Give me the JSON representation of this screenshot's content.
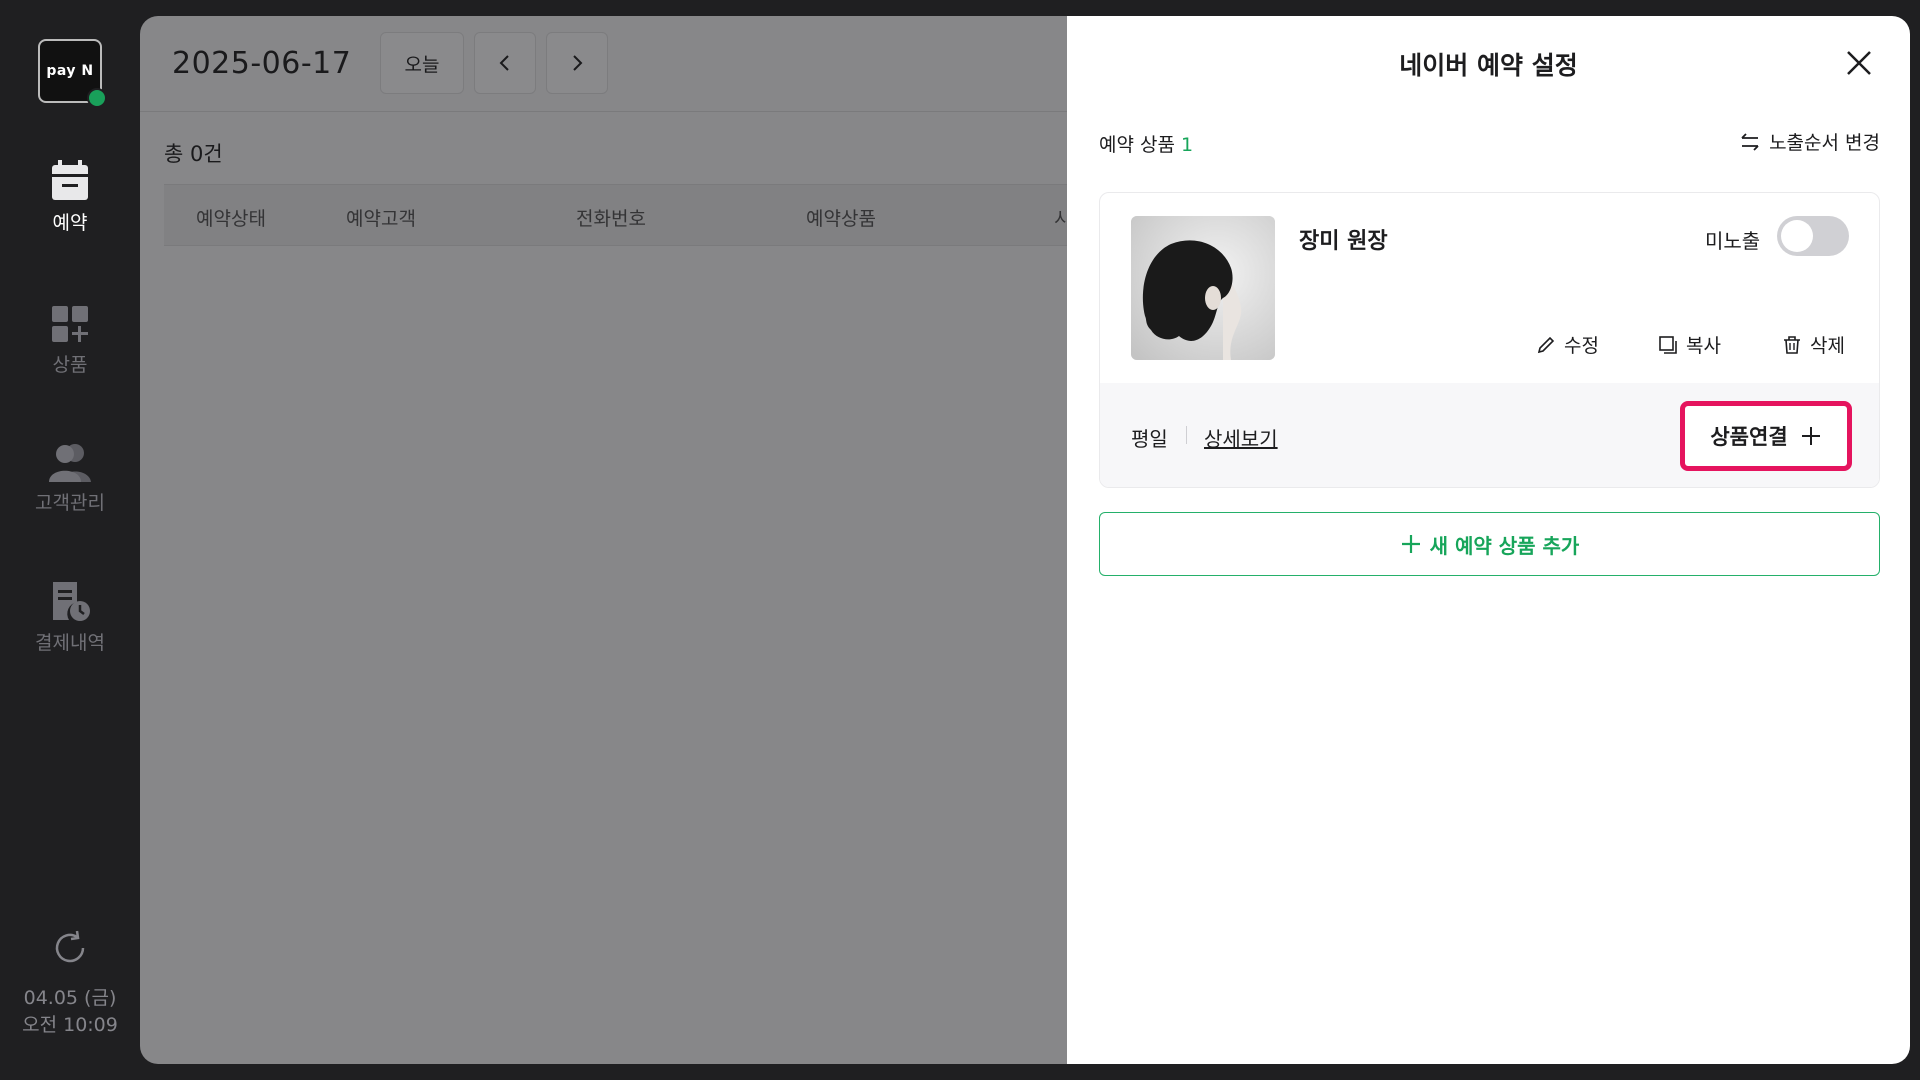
{
  "sidebar": {
    "logo_text": "pay N",
    "items": [
      {
        "label": "예약",
        "icon": "calendar-icon",
        "active": true
      },
      {
        "label": "상품",
        "icon": "grid-plus-icon",
        "active": false
      },
      {
        "label": "고객관리",
        "icon": "users-icon",
        "active": false
      },
      {
        "label": "결제내역",
        "icon": "receipt-clock-icon",
        "active": false
      }
    ],
    "clock_date": "04.05 (금)",
    "clock_time": "오전 10:09"
  },
  "main": {
    "date": "2025-06-17",
    "today_label": "오늘",
    "total": "총 0건",
    "columns": [
      "예약상태",
      "예약고객",
      "전화번호",
      "예약상품",
      "시"
    ]
  },
  "panel": {
    "title": "네이버 예약 설정",
    "section_label": "예약 상품",
    "section_count": "1",
    "order_change_label": "노출순서 변경",
    "product": {
      "name": "장미 원장",
      "visibility_label": "미노출",
      "toggle_on": false,
      "edit_label": "수정",
      "copy_label": "복사",
      "delete_label": "삭제",
      "day_label": "평일",
      "detail_label": "상세보기",
      "link_label": "상품연결"
    },
    "add_button_label": "새 예약 상품 추가"
  },
  "colors": {
    "accent_green": "#17a55a",
    "highlight_red": "#e5145e"
  }
}
